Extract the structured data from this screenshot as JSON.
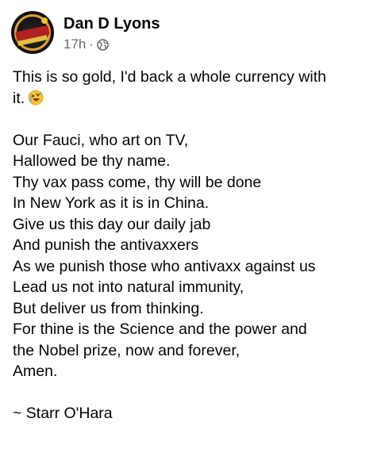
{
  "post": {
    "author": "Dan D Lyons",
    "time": "17h",
    "separator": "·",
    "privacy_icon": "globe-icon",
    "intro_line_1": "This is so gold, I'd back a whole currency with",
    "intro_line_2": "it.",
    "emoji_icon": "rolling-on-floor-laughing-emoji",
    "poem": [
      "Our Fauci, who art on TV,",
      "Hallowed be thy name.",
      "Thy vax pass come, thy will be done",
      "In New York as it is in China.",
      "Give us this day our daily jab",
      "And punish the antivaxxers",
      "As we punish those who antivaxx against us",
      "Lead us not into natural immunity,",
      "But deliver us from thinking.",
      "For thine is the Science and the power and",
      "the Nobel prize, now and forever,",
      "Amen."
    ],
    "signature": "~ Starr O'Hara"
  },
  "colors": {
    "text": "#050505",
    "secondary_text": "#65676b",
    "background": "#ffffff"
  }
}
